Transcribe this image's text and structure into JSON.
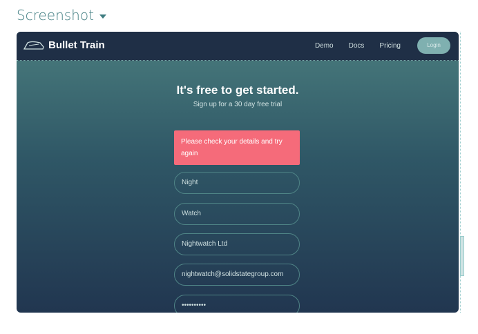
{
  "page": {
    "title": "Screenshot"
  },
  "nav": {
    "brand": "Bullet Train",
    "links": [
      "Demo",
      "Docs",
      "Pricing"
    ],
    "login": "Login"
  },
  "hero": {
    "heading": "It's free to get started.",
    "subheading": "Sign up for a 30 day free trial"
  },
  "error": "Please check your details and try again",
  "form": {
    "first_name": "Night",
    "last_name": "Watch",
    "company": "Nightwatch Ltd",
    "email": "nightwatch@solidstategroup.com",
    "password": "••••••••••"
  }
}
